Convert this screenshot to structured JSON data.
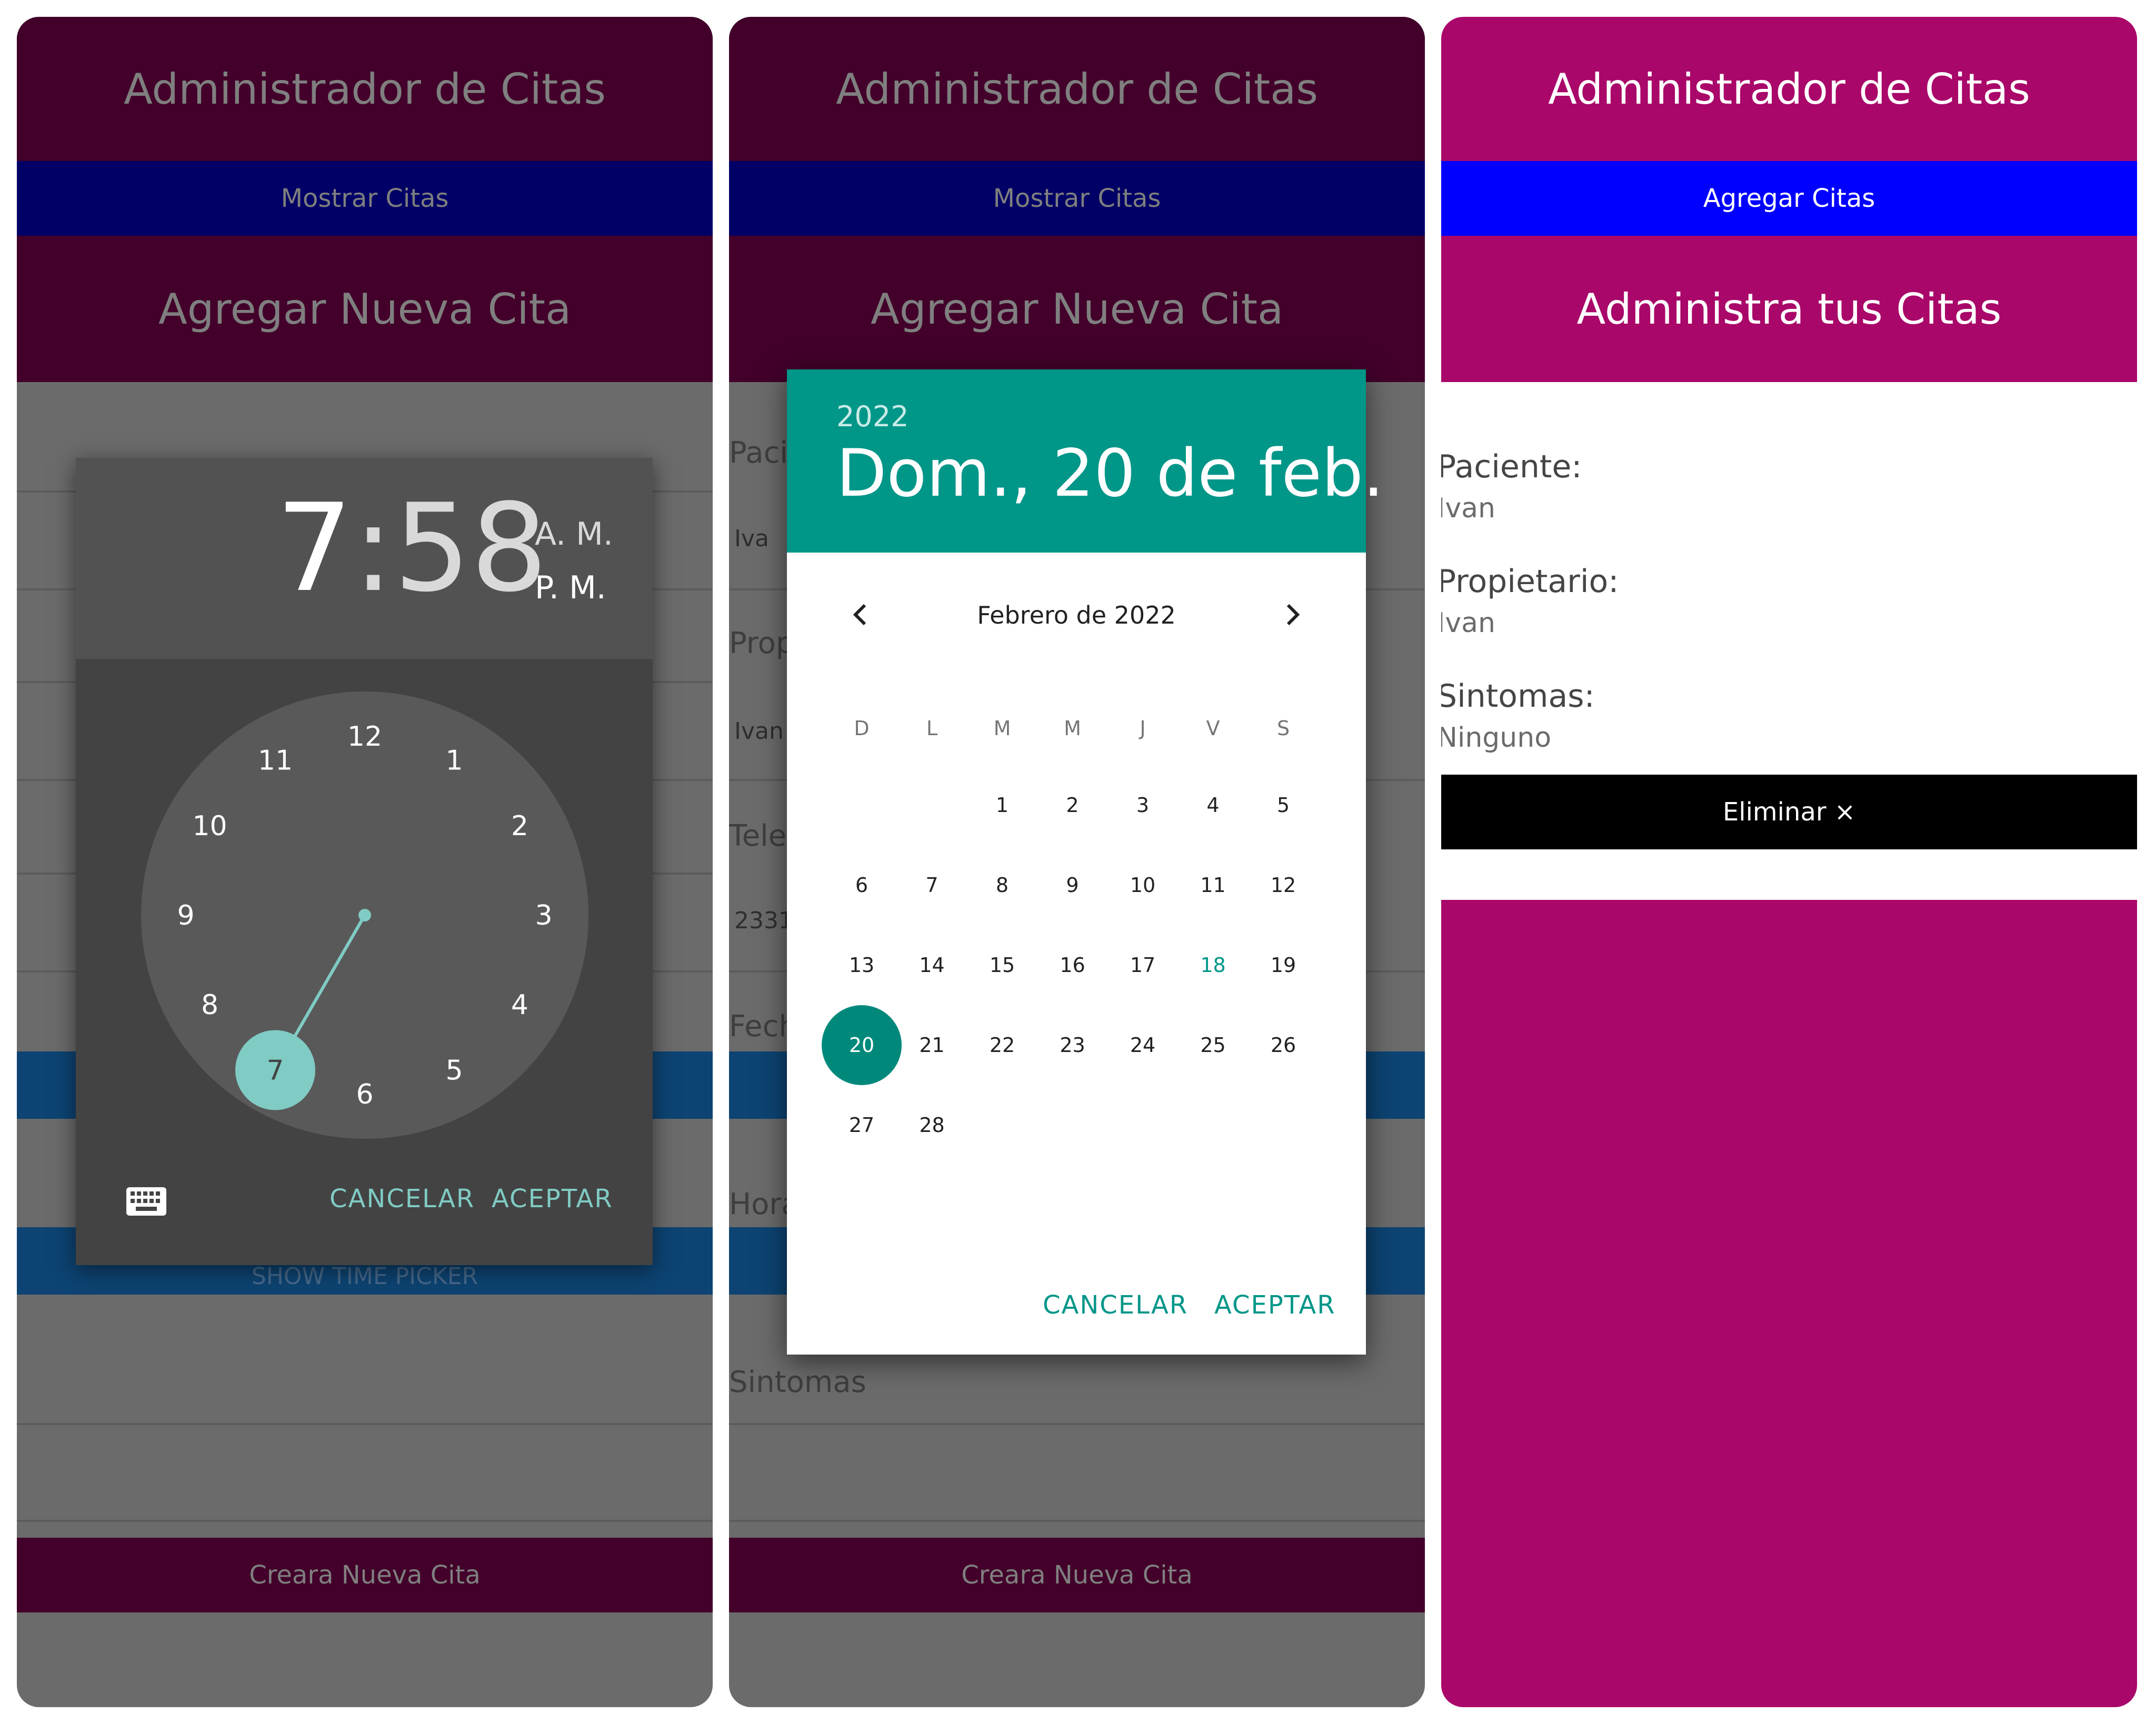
{
  "app_title": "Administrador de Citas",
  "screen1": {
    "nav_button": "Mostrar Citas",
    "form_title": "Agregar Nueva Cita",
    "hidden_button": "SHOW TIME PICKER",
    "create_button": "Creara Nueva Cita",
    "time_picker": {
      "hour": "7",
      "separator": ":",
      "minute": "58",
      "am": "A. M.",
      "pm": "P. M.",
      "selected_hour": 7,
      "minute_value": 58,
      "dial_numbers": [
        "12",
        "1",
        "2",
        "3",
        "4",
        "5",
        "6",
        "7",
        "8",
        "9",
        "10",
        "11"
      ],
      "cancel": "CANCELAR",
      "accept": "ACEPTAR"
    }
  },
  "screen2": {
    "nav_button": "Mostrar Citas",
    "form_title": "Agregar Nueva Cita",
    "labels": {
      "paciente": "Paci",
      "propietario": "Prop",
      "telefono": "Tele",
      "fecha": "Fech",
      "hora": "Hora",
      "sintomas": "Sintomas"
    },
    "values": {
      "paciente": "Iva",
      "propietario": "Ivan",
      "telefono": "2331"
    },
    "create_button": "Creara Nueva Cita",
    "date_picker": {
      "year": "2022",
      "date": "Dom., 20 de feb.",
      "month_label": "Febrero de 2022",
      "weekdays": [
        "D",
        "L",
        "M",
        "M",
        "J",
        "V",
        "S"
      ],
      "first_weekday_index": 2,
      "days_in_month": 28,
      "today": 18,
      "selected": 20,
      "cancel": "CANCELAR",
      "accept": "ACEPTAR"
    }
  },
  "screen3": {
    "nav_button": "Agregar Citas",
    "list_title": "Administra tus Citas",
    "paciente_label": "Paciente:",
    "paciente_value": "Ivan",
    "propietario_label": "Propietario:",
    "propietario_value": "Ivan",
    "sintomas_label": "Sintomas:",
    "sintomas_value": "Ninguno",
    "delete_button": "Eliminar ×"
  },
  "colors": {
    "header_dark": "#42002a",
    "nav_dark": "#000066",
    "header_bright": "#a90769",
    "nav_bright": "#0000ff",
    "accent_teal": "#009688",
    "clock_teal": "#80cbc4"
  }
}
